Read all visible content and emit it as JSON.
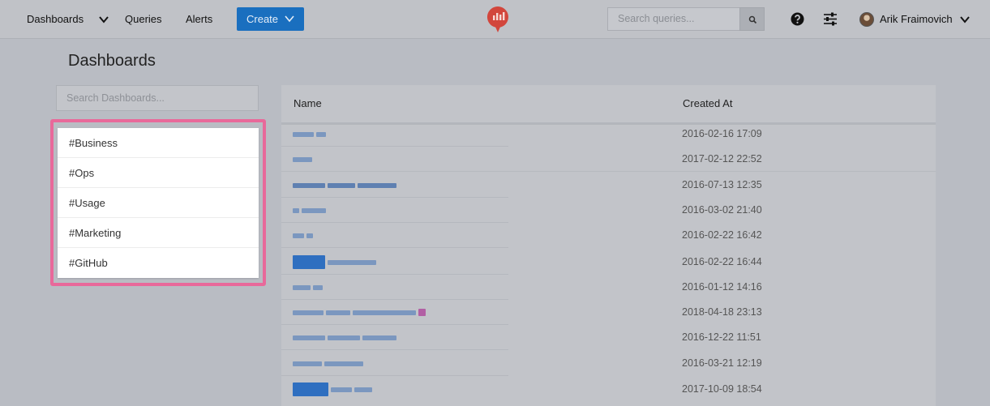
{
  "nav": {
    "dashboards_label": "Dashboards",
    "queries_label": "Queries",
    "alerts_label": "Alerts",
    "create_label": "Create",
    "search_placeholder": "Search queries...",
    "user_name": "Arik Fraimovich"
  },
  "page": {
    "title": "Dashboards",
    "search_placeholder": "Search Dashboards..."
  },
  "tags": [
    "#Business",
    "#Ops",
    "#Usage",
    "#Marketing",
    "#GitHub"
  ],
  "table": {
    "columns": [
      "Name",
      "Created At"
    ],
    "rows": [
      {
        "name": "",
        "created_at": "2016-02-16 17:09"
      },
      {
        "name": "",
        "created_at": "2017-02-12 22:52"
      },
      {
        "name": "",
        "created_at": "2016-07-13 12:35"
      },
      {
        "name": "",
        "created_at": "2016-03-02 21:40"
      },
      {
        "name": "",
        "created_at": "2016-02-22 16:42"
      },
      {
        "name": "",
        "created_at": "2016-02-22 16:44"
      },
      {
        "name": "",
        "created_at": "2016-01-12 14:16"
      },
      {
        "name": "",
        "created_at": "2018-04-18 23:13"
      },
      {
        "name": "",
        "created_at": "2016-12-22 11:51"
      },
      {
        "name": "",
        "created_at": "2016-03-21 12:19"
      },
      {
        "name": "",
        "created_at": "2017-10-09 18:54"
      }
    ]
  },
  "colors": {
    "accent": "#1a6fbf",
    "highlight": "#e8699a",
    "logo": "#d2463c"
  },
  "icons": [
    "chevron-down-icon",
    "redash-logo-icon",
    "search-icon",
    "help-icon",
    "settings-sliders-icon"
  ]
}
